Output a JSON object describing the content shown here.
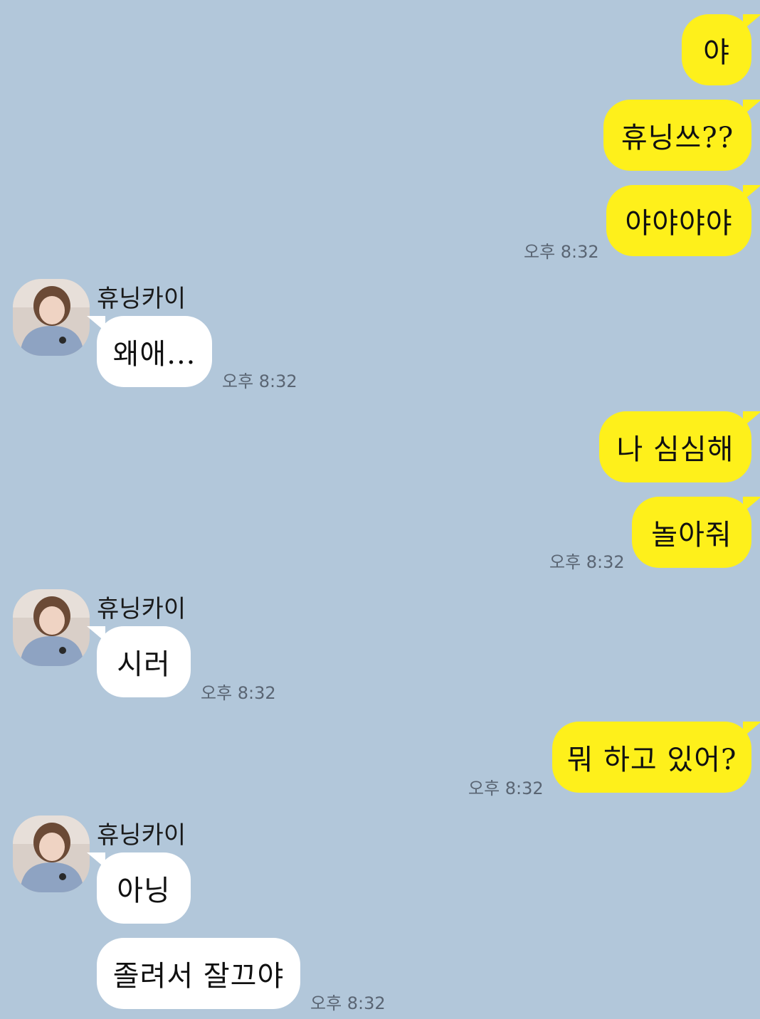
{
  "colors": {
    "background": "#b2c7da",
    "mine_bubble": "#fef01b",
    "their_bubble": "#ffffff"
  },
  "messages": {
    "m1": "야",
    "m2": "휴닝쓰??",
    "m3": "야야야야",
    "t1": "오후 8:32",
    "g1_name": "휴닝카이",
    "r1": "왜애...",
    "t2": "오후 8:32",
    "m4": "나 심심해",
    "m5": "놀아줘",
    "t3": "오후 8:32",
    "g2_name": "휴닝카이",
    "r2": "시러",
    "t4": "오후 8:32",
    "m6": "뭐 하고 있어?",
    "t5": "오후 8:32",
    "g3_name": "휴닝카이",
    "r3": "아닝",
    "r4": "졸려서 잘끄야",
    "t6": "오후 8:32"
  },
  "avatar_icon": "profile-photo-icon"
}
